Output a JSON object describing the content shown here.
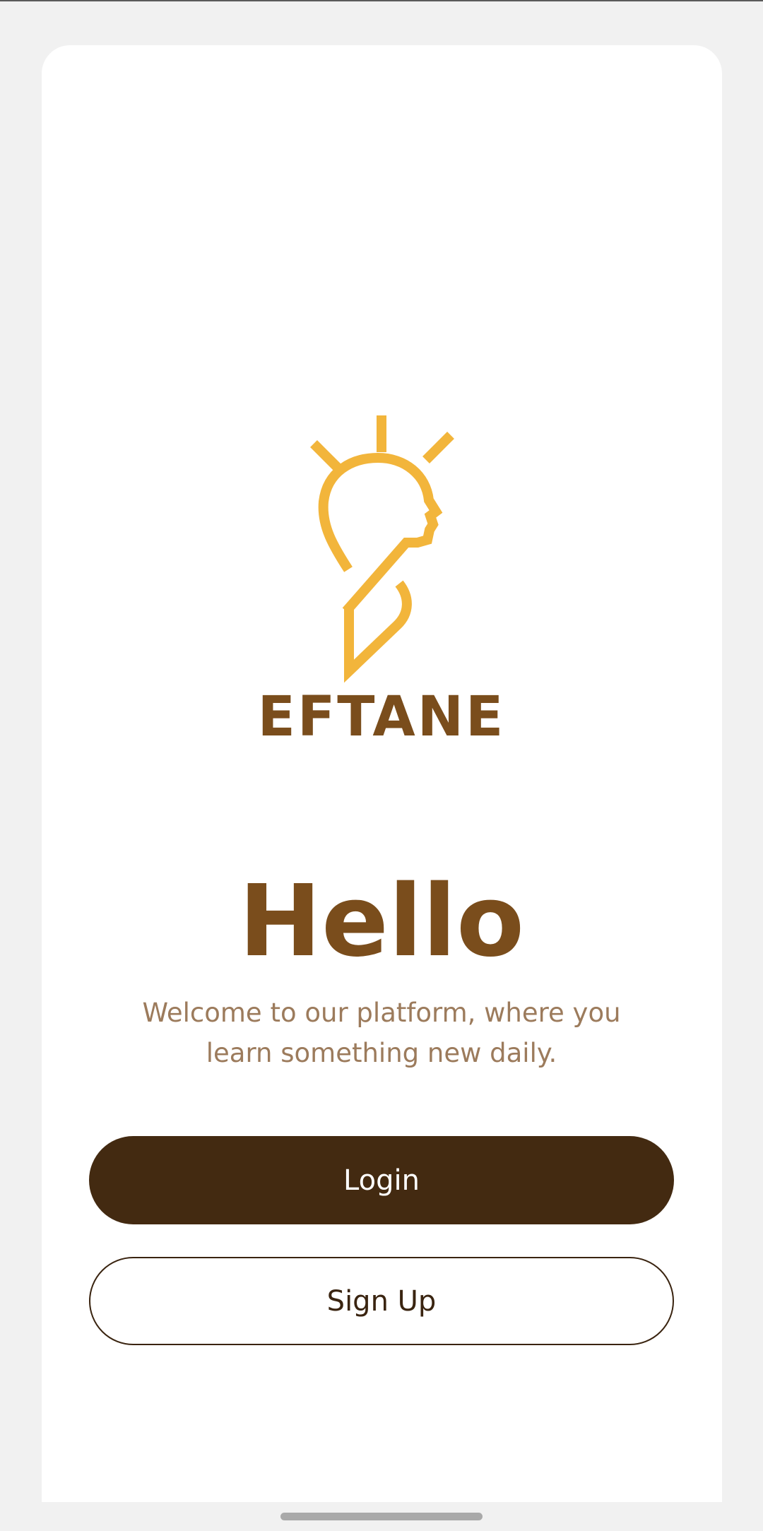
{
  "brand": {
    "name": "EFTANE",
    "logo_icon": "lightbulb-head-icon"
  },
  "welcome": {
    "title": "Hello",
    "message": "Welcome to our platform, where you learn something new daily."
  },
  "actions": {
    "login_label": "Login",
    "signup_label": "Sign Up"
  },
  "colors": {
    "accent_gold": "#f2b53b",
    "brand_brown": "#7a4d1c",
    "button_dark": "#432a11",
    "subtext": "#9c7b5c"
  }
}
